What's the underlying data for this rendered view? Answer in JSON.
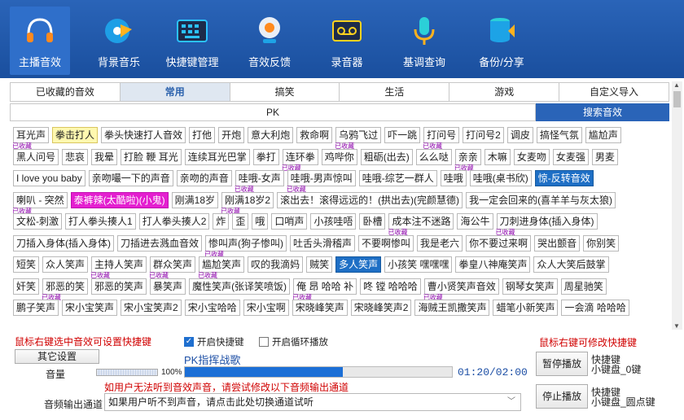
{
  "toolbar": [
    {
      "name": "host-sound",
      "label": "主播音效",
      "icon": "headphones-icon",
      "active": true
    },
    {
      "name": "bg-music",
      "label": "背景音乐",
      "icon": "music-disc-icon"
    },
    {
      "name": "hotkey-manage",
      "label": "快捷键管理",
      "icon": "keyboard-icon"
    },
    {
      "name": "sound-feedback",
      "label": "音效反馈",
      "icon": "webcam-icon"
    },
    {
      "name": "recorder",
      "label": "录音器",
      "icon": "cassette-icon"
    },
    {
      "name": "pitch-query",
      "label": "基调查询",
      "icon": "microphone-icon"
    },
    {
      "name": "backup-share",
      "label": "备份/分享",
      "icon": "database-icon"
    }
  ],
  "tabs": [
    "已收藏的音效",
    "常用",
    "搞笑",
    "生活",
    "游戏",
    "自定义导入"
  ],
  "pk_tab": "PK",
  "search_tab": "搜索音效",
  "fav_label": "已收藏",
  "rows": [
    [
      {
        "t": "耳光声",
        "f": true
      },
      {
        "t": "拳击打人",
        "c": "yellow"
      },
      {
        "t": "拳头快速打人音效"
      },
      {
        "t": "打他"
      },
      {
        "t": "开炮"
      },
      {
        "t": "意大利炮"
      },
      {
        "t": "救命啊"
      },
      {
        "t": "乌鸦飞过",
        "f": true
      },
      {
        "t": "吓一跳"
      },
      {
        "t": "打问号",
        "f": true
      },
      {
        "t": "打问号2"
      },
      {
        "t": "调皮"
      },
      {
        "t": "搞怪气氛"
      },
      {
        "t": "尴尬声"
      }
    ],
    [
      {
        "t": "黑人问号"
      },
      {
        "t": "悲哀"
      },
      {
        "t": "我晕"
      },
      {
        "t": "打脸 鞭 耳光"
      },
      {
        "t": "连续耳光巴掌"
      },
      {
        "t": "拳打"
      },
      {
        "t": "连环拳",
        "f": true
      },
      {
        "t": "鸡哔你"
      },
      {
        "t": "粗砺(出去)"
      },
      {
        "t": "么么哒"
      },
      {
        "t": "亲亲",
        "f": true
      },
      {
        "t": "木嘛"
      },
      {
        "t": "女麦吻"
      },
      {
        "t": "女麦强"
      },
      {
        "t": "男麦"
      }
    ],
    [
      {
        "t": "I love you baby"
      },
      {
        "t": "亲吻嘬一下的声音"
      },
      {
        "t": "亲吻的声音"
      },
      {
        "t": "哇哦-女声",
        "f": true
      },
      {
        "t": "哇哦-男声惊叫",
        "f": true
      },
      {
        "t": "哇哦-综艺一群人"
      },
      {
        "t": "哇哦"
      },
      {
        "t": "哇哦(桌书欣)"
      },
      {
        "t": "惊-反转音效",
        "c": "blue"
      }
    ],
    [
      {
        "t": "喇叭 - 突然",
        "f": true
      },
      {
        "t": "泰裤辣(太酷啦)(小鬼)",
        "c": "magenta"
      },
      {
        "t": "刚满18岁"
      },
      {
        "t": "刚满18岁2",
        "f": true
      },
      {
        "t": "滚出去！滚得远远的！(拱出去)(完颜慧德)"
      },
      {
        "t": "我一定会回来的(喜羊羊与灰太狼)"
      }
    ],
    [
      {
        "t": "文松-刺激"
      },
      {
        "t": "打人拳头揍人1"
      },
      {
        "t": "打人拳头揍人2"
      },
      {
        "t": "炸"
      },
      {
        "t": "歪"
      },
      {
        "t": "哦"
      },
      {
        "t": "口哨声"
      },
      {
        "t": "小孩哇唔"
      },
      {
        "t": "卧槽"
      },
      {
        "t": "成本注不迷路",
        "f": true
      },
      {
        "t": "海公牛"
      },
      {
        "t": "刀刺进身体(插入身体)",
        "f": true
      }
    ],
    [
      {
        "t": "刀插入身体(插入身体)"
      },
      {
        "t": "刀插进去溅血音效"
      },
      {
        "t": "惨叫声(狗子惨叫)",
        "f": true
      },
      {
        "t": "吐舌头滑稽声"
      },
      {
        "t": "不要啊惨叫"
      },
      {
        "t": "我是老六"
      },
      {
        "t": "你不要过来啊"
      },
      {
        "t": "哭出颤音"
      },
      {
        "t": "你别笑"
      }
    ],
    [
      {
        "t": "短笑"
      },
      {
        "t": "众人笑声"
      },
      {
        "t": "主持人笑声",
        "f": true
      },
      {
        "t": "群众笑声",
        "f": true
      },
      {
        "t": "尴尬笑声",
        "f": true
      },
      {
        "t": "叹的我滴妈"
      },
      {
        "t": "贼笑"
      },
      {
        "t": "多人笑声",
        "c": "blue"
      },
      {
        "t": "小孩笑 嘿嘿嘿"
      },
      {
        "t": "拳皇八神庵笑声"
      },
      {
        "t": "众人大笑后鼓掌"
      }
    ],
    [
      {
        "t": "奸笑"
      },
      {
        "t": "邪恶的笑",
        "f": true
      },
      {
        "t": "邪恶的笑声"
      },
      {
        "t": "暴笑声"
      },
      {
        "t": "魔性笑声(张译笑喷饭)"
      },
      {
        "t": "俺 昂 哈哈 补",
        "f": true
      },
      {
        "t": "咚 镗 哈哈哈"
      },
      {
        "t": "曹小贤笑声音效",
        "f": true
      },
      {
        "t": "钢琴女笑声"
      },
      {
        "t": "周星驰笑"
      }
    ],
    [
      {
        "t": "鹏子笑声"
      },
      {
        "t": "宋小宝笑声"
      },
      {
        "t": "宋小宝笑声2"
      },
      {
        "t": "宋小宝哈哈"
      },
      {
        "t": "宋小宝啊"
      },
      {
        "t": "宋晓峰笑声"
      },
      {
        "t": "宋晓峰笑声2"
      },
      {
        "t": "海贼王凯撒笑声"
      },
      {
        "t": "蜡笔小新笑声"
      },
      {
        "t": "一会滴 哈哈哈"
      }
    ]
  ],
  "bottom": {
    "hint_left": "鼠标右键选中音效可设置快捷键",
    "hotkey_check": "开启快捷键",
    "loop_check": "开启循环播放",
    "hint_right": "鼠标右键可修改快捷键",
    "other_settings": "其它设置",
    "now_playing": "PK指挥战歌",
    "volume_label": "音量",
    "volume_pct": "100%",
    "progress": 0.59,
    "time": "01:20/02:00",
    "pause_btn": "暂停播放",
    "pause_hotkey": [
      "快捷键",
      "小键盘_0键"
    ],
    "warning": "如用户无法听到音效声音，请尝试修改以下音频输出通道",
    "output_label": "音频输出通道",
    "output_value": "如果用户听不到声音，请点击此处切换通道试听",
    "stop_btn": "停止播放",
    "stop_hotkey": [
      "快捷键",
      "小键盘_圆点键"
    ]
  }
}
